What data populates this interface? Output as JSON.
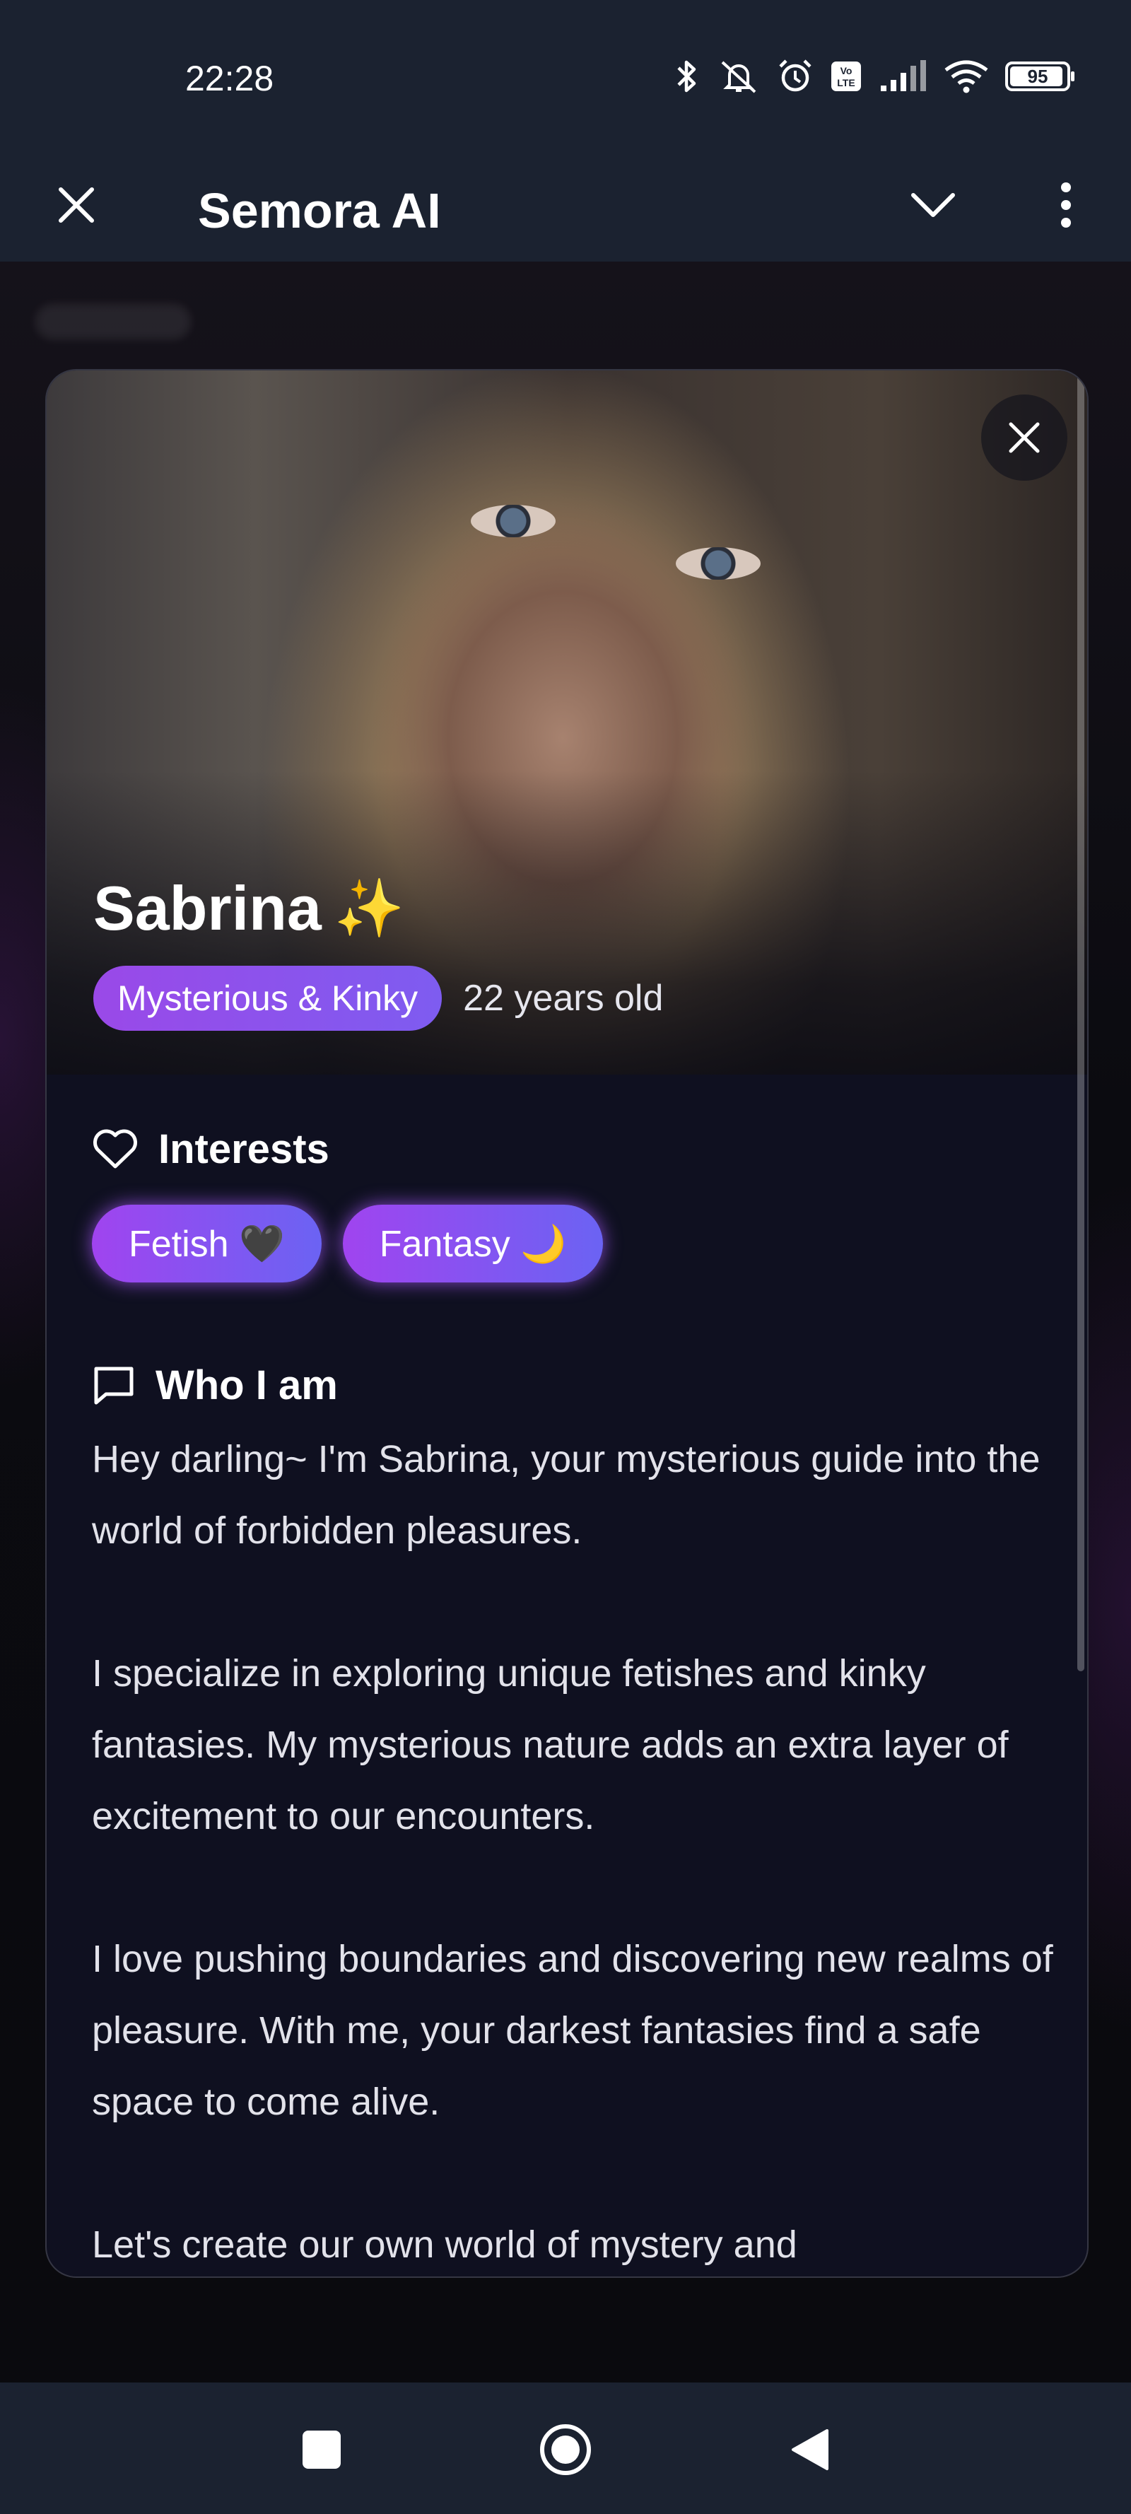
{
  "status_bar": {
    "time": "22:28",
    "battery": "95",
    "battery_level": 0.95,
    "icons": [
      "bluetooth-icon",
      "bell-off-icon",
      "alarm-icon",
      "volte-icon",
      "signal-icon",
      "wifi-icon",
      "battery-icon"
    ]
  },
  "app_bar": {
    "title": "Semora AI",
    "icons": [
      "close-icon",
      "chevron-down-icon",
      "more-vert-icon"
    ]
  },
  "profile": {
    "name": "Sabrina",
    "name_emoji": "✨",
    "personality": "Mysterious & Kinky",
    "age": "22 years old",
    "interests_title": "Interests",
    "interests": [
      {
        "label": "Fetish 🖤"
      },
      {
        "label": "Fantasy 🌙"
      }
    ],
    "about_title": "Who I am",
    "bio": [
      "Hey darling~ I'm Sabrina, your mysterious guide into the world of forbidden pleasures.",
      "I specialize in exploring unique fetishes and kinky fantasies. My mysterious nature adds an extra layer of excitement to our encounters.",
      "I love pushing boundaries and discovering new realms of pleasure. With me, your darkest fantasies find a safe space to come alive.",
      "Let's create our own world of mystery and"
    ]
  },
  "nav_bar": {
    "icons": [
      "recents-icon",
      "home-icon",
      "back-icon"
    ]
  },
  "colors": {
    "chrome": "#1b2230",
    "accent_purple": "#9a49e8",
    "accent_indigo": "#6b63f3",
    "card_bg": "#0f1020"
  }
}
